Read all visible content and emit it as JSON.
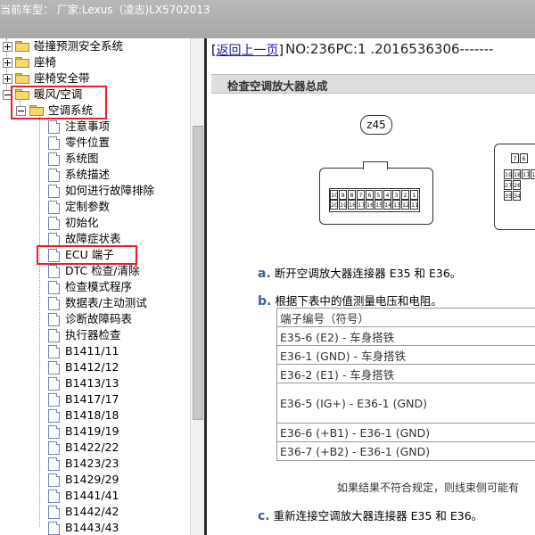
{
  "window": {
    "title": "当前车型：  厂家:Lexus（凌志)LX5702013"
  },
  "sidebar": {
    "items": [
      {
        "label": "碰撞预测安全系统",
        "type": "folder",
        "expanded": false
      },
      {
        "label": "座椅",
        "type": "folder",
        "expanded": false
      },
      {
        "label": "座椅安全带",
        "type": "folder",
        "expanded": false
      },
      {
        "label": "暖风/空调",
        "type": "folder",
        "expanded": true
      },
      {
        "label": "空调系统",
        "type": "folder",
        "expanded": true
      },
      {
        "label": "注意事项",
        "type": "doc"
      },
      {
        "label": "零件位置",
        "type": "doc"
      },
      {
        "label": "系统图",
        "type": "doc"
      },
      {
        "label": "系统描述",
        "type": "doc"
      },
      {
        "label": "如何进行故障排除",
        "type": "doc"
      },
      {
        "label": "定制参数",
        "type": "doc"
      },
      {
        "label": "初始化",
        "type": "doc"
      },
      {
        "label": "故障症状表",
        "type": "doc"
      },
      {
        "label": "ECU 端子",
        "type": "doc",
        "selected": true
      },
      {
        "label": "DTC 检查/清除",
        "type": "doc"
      },
      {
        "label": "检查模式程序",
        "type": "doc"
      },
      {
        "label": "数据表/主动测试",
        "type": "doc"
      },
      {
        "label": "诊断故障码表",
        "type": "doc"
      },
      {
        "label": "执行器检查",
        "type": "doc"
      },
      {
        "label": "B1411/11",
        "type": "doc"
      },
      {
        "label": "B1412/12",
        "type": "doc"
      },
      {
        "label": "B1413/13",
        "type": "doc"
      },
      {
        "label": "B1417/17",
        "type": "doc"
      },
      {
        "label": "B1418/18",
        "type": "doc"
      },
      {
        "label": "B1419/19",
        "type": "doc"
      },
      {
        "label": "B1422/22",
        "type": "doc"
      },
      {
        "label": "B1423/23",
        "type": "doc"
      },
      {
        "label": "B1429/29",
        "type": "doc"
      },
      {
        "label": "B1441/41",
        "type": "doc"
      },
      {
        "label": "B1442/42",
        "type": "doc"
      },
      {
        "label": "B1443/43",
        "type": "doc"
      }
    ]
  },
  "main": {
    "back_link": "返回上一页",
    "doc_number": "NO:236PC:1 .2016536306-------",
    "section_title": "检查空调放大器总成",
    "connector_label": "z45",
    "connector_top_row": [
      "10",
      "9",
      "8",
      "7",
      "6",
      "5",
      "4",
      "3",
      "2",
      "1"
    ],
    "connector_bottom_row": [
      "20",
      "19",
      "18",
      "17",
      "16",
      "15",
      "14",
      "13",
      "12",
      "11"
    ],
    "connector2_rows": [
      [
        "7",
        "6"
      ],
      [
        "19",
        "18",
        "17",
        "16"
      ],
      [
        "27",
        "26"
      ],
      [
        "35",
        "34"
      ]
    ],
    "steps": {
      "a_letter": "a.",
      "a_text": "断开空调放大器连接器 E35 和 E36。",
      "b_letter": "b.",
      "b_text": "根据下表中的值测量电压和电阻。",
      "c_letter": "c.",
      "c_text": "重新连接空调放大器连接器 E35 和 E36。"
    },
    "table": {
      "header": "端子编号（符号）",
      "rows": [
        "E35-6 (E2) - 车身搭铁",
        "E36-1 (GND) - 车身搭铁",
        "E36-2 (E1) - 车身搭铁",
        "E36-5 (IG+) - E36-1 (GND)",
        "E36-6 (+B1) - E36-1 (GND)",
        "E36-7 (+B2) - E36-1 (GND)"
      ]
    },
    "result_note": "如果结果不符合规定，则线束侧可能有"
  }
}
